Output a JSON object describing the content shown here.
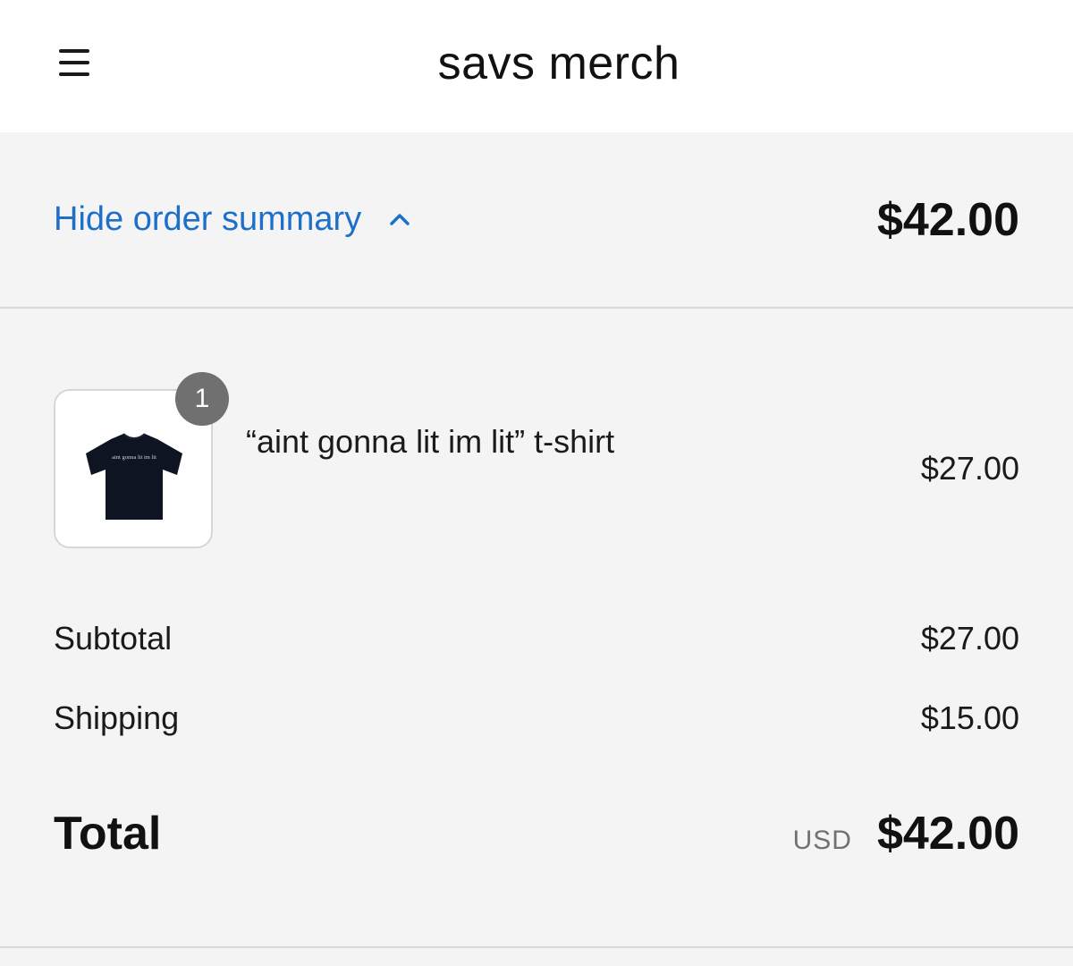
{
  "header": {
    "store_name": "savs merch",
    "menu_icon": "hamburger-menu-icon"
  },
  "summary_bar": {
    "toggle_label": "Hide order summary",
    "toggle_icon": "chevron-up-icon",
    "total": "$42.00",
    "link_color": "#1d6fc9"
  },
  "line_items": [
    {
      "quantity": "1",
      "name": "“aint gonna lit im lit” t-shirt",
      "price": "$27.00",
      "image_icon": "black-tshirt-thumbnail",
      "shirt_print": "aint gonna lit im lit"
    }
  ],
  "costs": {
    "subtotal_label": "Subtotal",
    "subtotal_value": "$27.00",
    "shipping_label": "Shipping",
    "shipping_value": "$15.00"
  },
  "total": {
    "label": "Total",
    "currency": "USD",
    "value": "$42.00"
  }
}
